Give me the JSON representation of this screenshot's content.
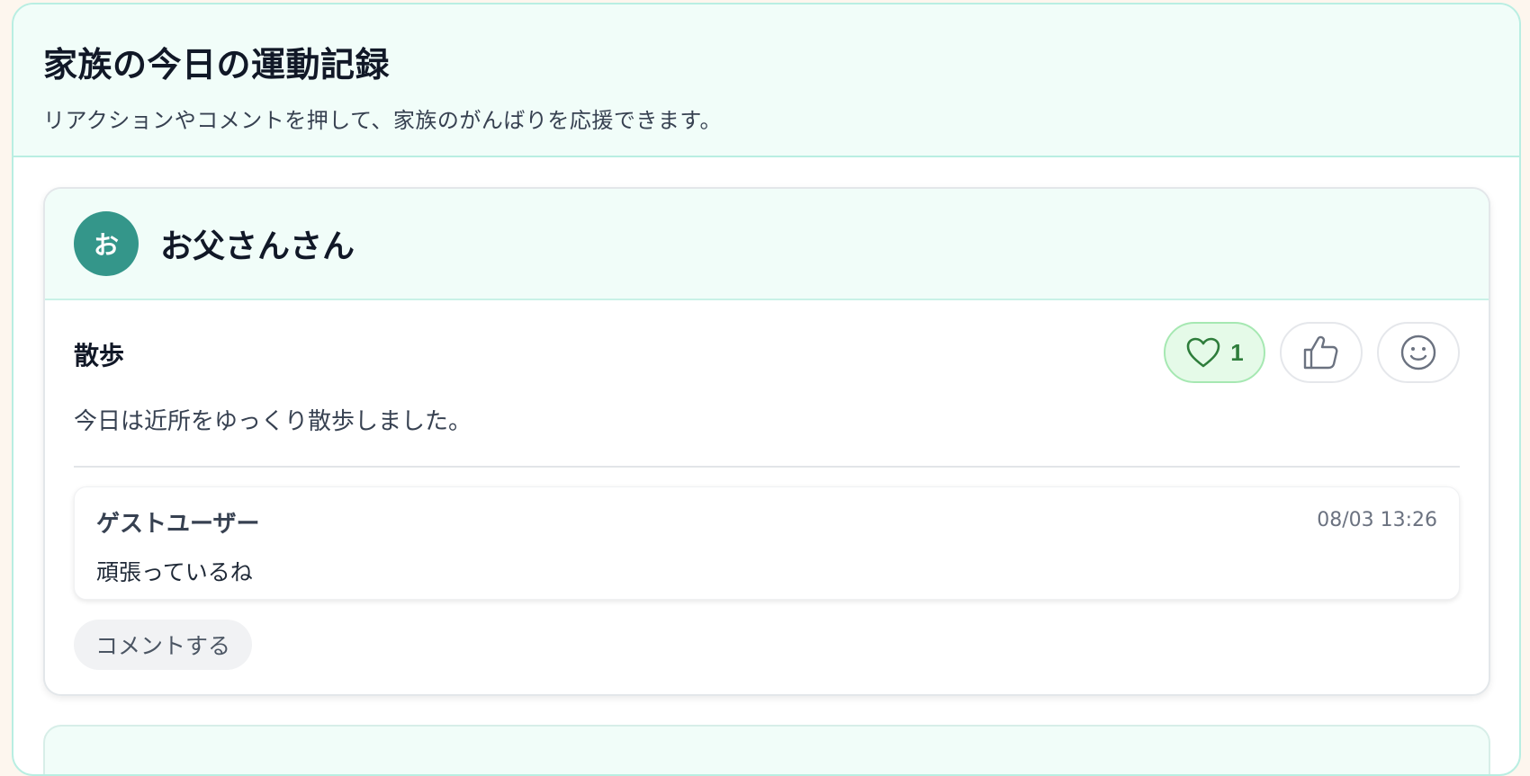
{
  "page": {
    "title": "家族の今日の運動記録",
    "subtitle": "リアクションやコメントを押して、家族のがんばりを応援できます。"
  },
  "colors": {
    "accent": "#34968a",
    "header_bg": "#f1fdf9",
    "active_reaction_bg": "#e5fae8",
    "active_reaction_text": "#2e7d3b"
  },
  "cards": [
    {
      "avatar_initial": "お",
      "member_name": "お父さんさん",
      "activity": "散歩",
      "note": "今日は近所をゆっくり散歩しました。",
      "reactions": [
        {
          "icon": "heart-icon",
          "count": "1",
          "active": true
        },
        {
          "icon": "thumbs-up-icon",
          "count": "",
          "active": false
        },
        {
          "icon": "smile-icon",
          "count": "",
          "active": false
        }
      ],
      "comments": [
        {
          "author": "ゲストユーザー",
          "time": "08/03 13:26",
          "text": "頑張っているね"
        }
      ],
      "comment_button_label": "コメントする"
    }
  ]
}
